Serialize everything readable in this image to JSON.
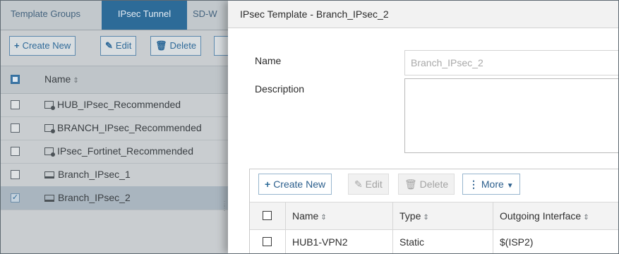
{
  "left_panel": {
    "tabs": [
      "Template Groups",
      "IPsec Tunnel",
      "SD-W"
    ],
    "toolbar": {
      "create_new": "Create New",
      "edit": "Edit",
      "delete": "Delete"
    },
    "table": {
      "header_name": "Name",
      "rows": [
        {
          "name": "HUB_IPsec_Recommended",
          "icon": "group-template-icon",
          "checked": false
        },
        {
          "name": "BRANCH_IPsec_Recommended",
          "icon": "group-template-icon",
          "checked": false
        },
        {
          "name": "IPsec_Fortinet_Recommended",
          "icon": "group-template-icon",
          "checked": false
        },
        {
          "name": "Branch_IPsec_1",
          "icon": "template-icon",
          "checked": false
        },
        {
          "name": "Branch_IPsec_2",
          "icon": "template-icon",
          "checked": true
        }
      ]
    }
  },
  "dialog": {
    "title": "IPsec Template - Branch_IPsec_2",
    "name_label": "Name",
    "name_value": "Branch_IPsec_2",
    "description_label": "Description",
    "description_value": "",
    "toolbar": {
      "create_new": "Create New",
      "edit": "Edit",
      "delete": "Delete",
      "more": "More"
    },
    "table": {
      "headers": [
        "Name",
        "Type",
        "Outgoing Interface"
      ],
      "rows": [
        {
          "name": "HUB1-VPN2",
          "type": "Static",
          "outgoing_interface": "$(ISP2)"
        }
      ]
    }
  },
  "colors": {
    "accent": "#2d6b98",
    "overlay_panel": "#c9cdd0"
  }
}
